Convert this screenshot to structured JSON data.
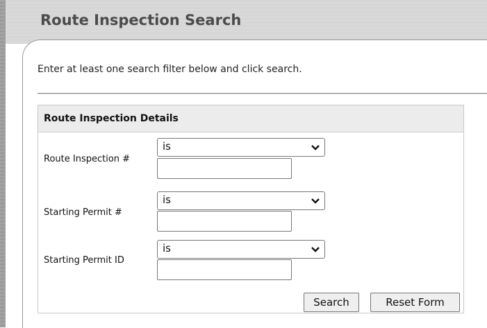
{
  "header": {
    "title": "Route Inspection Search"
  },
  "instruction": "Enter at least one search filter below and click search.",
  "panel": {
    "title": "Route Inspection Details",
    "rows": [
      {
        "label": "Route Inspection #",
        "operator": "is",
        "value": ""
      },
      {
        "label": "Starting Permit #",
        "operator": "is",
        "value": ""
      },
      {
        "label": "Starting Permit ID",
        "operator": "is",
        "value": ""
      }
    ]
  },
  "buttons": {
    "search": "Search",
    "reset": "Reset Form"
  },
  "icons": {
    "dropdown": "chevron-down-icon"
  }
}
